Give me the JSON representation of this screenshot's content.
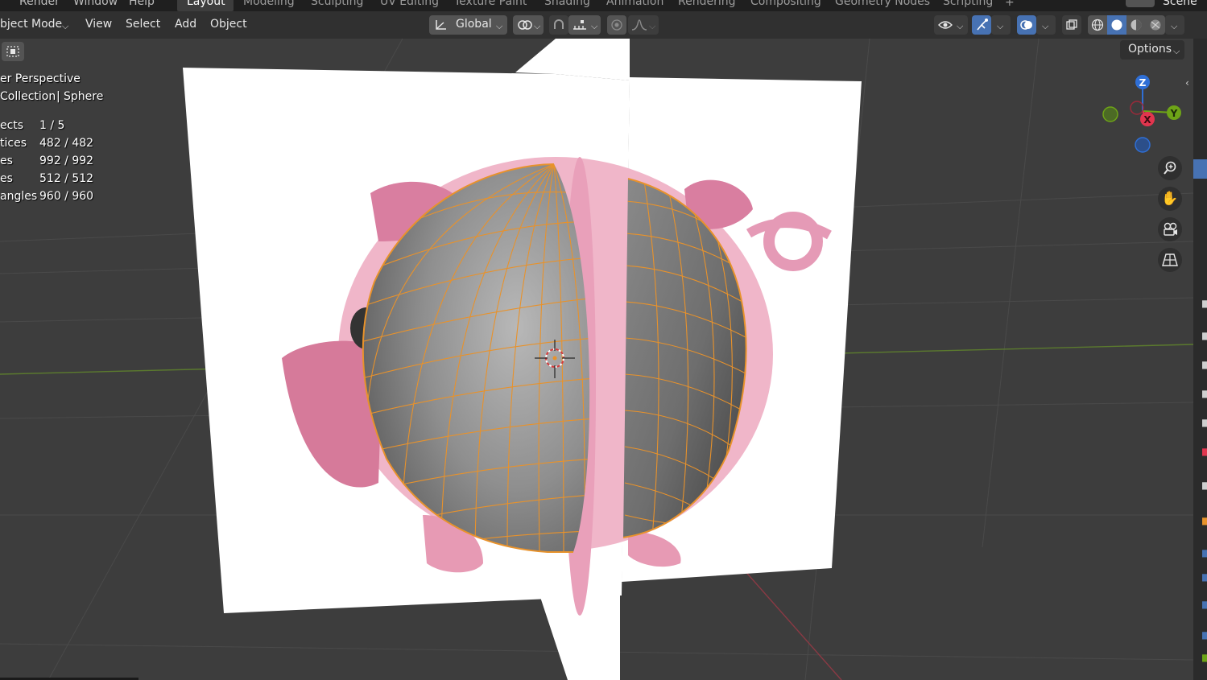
{
  "workspace_tabs": [
    {
      "label": "Layout",
      "active": true
    },
    {
      "label": "Modeling"
    },
    {
      "label": "Sculpting"
    },
    {
      "label": "UV Editing"
    },
    {
      "label": "Texture Paint"
    },
    {
      "label": "Shading"
    },
    {
      "label": "Animation"
    },
    {
      "label": "Rendering"
    },
    {
      "label": "Compositing"
    },
    {
      "label": "Geometry Nodes"
    },
    {
      "label": "Scripting"
    }
  ],
  "top_menu": {
    "render": "Render",
    "window": "Window",
    "help": "Help",
    "add_tab": "+",
    "scene": "Scene"
  },
  "header": {
    "mode": "bject Mode",
    "menus": [
      "View",
      "Select",
      "Add",
      "Object"
    ],
    "transform_orientation": "Global"
  },
  "viewport_info": {
    "view_name": "er Perspective",
    "collection": "Collection",
    "object": "Sphere",
    "stats": [
      {
        "label": "ects",
        "value": "1 / 5"
      },
      {
        "label": "tices",
        "value": "482 / 482"
      },
      {
        "label": "es",
        "value": "992 / 992"
      },
      {
        "label": "es",
        "value": "512 / 512"
      },
      {
        "label": "angles",
        "value": "960 / 960"
      }
    ]
  },
  "options_label": "Options",
  "gizmo": {
    "z": "Z",
    "y": "Y",
    "x": "X"
  },
  "colors": {
    "z_axis": "#2f6fd6",
    "y_axis": "#6ea417",
    "x_axis": "#e2354e",
    "selection": "#e8922b",
    "active_button": "#4772b3"
  }
}
